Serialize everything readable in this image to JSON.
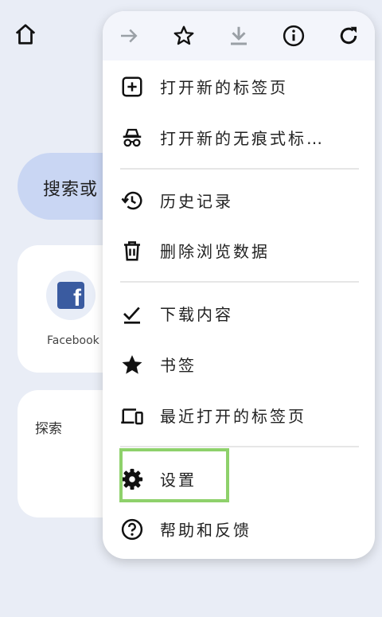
{
  "background": {
    "search_text": "搜索或",
    "shortcut_label": "Facebook",
    "explore_title": "探索"
  },
  "toolbar": {
    "icons": [
      "forward-icon",
      "star-outline-icon",
      "download-icon",
      "info-icon",
      "refresh-icon"
    ]
  },
  "menu": {
    "items": [
      {
        "label": "打开新的标签页",
        "icon": "new-tab-icon"
      },
      {
        "label": "打开新的无痕式标…",
        "icon": "incognito-icon"
      },
      {
        "label": "历史记录",
        "icon": "history-icon"
      },
      {
        "label": "删除浏览数据",
        "icon": "trash-icon"
      },
      {
        "label": "下载内容",
        "icon": "downloads-icon"
      },
      {
        "label": "书签",
        "icon": "star-filled-icon"
      },
      {
        "label": "最近打开的标签页",
        "icon": "devices-icon"
      },
      {
        "label": "设置",
        "icon": "gear-icon"
      },
      {
        "label": "帮助和反馈",
        "icon": "help-icon"
      }
    ]
  },
  "colors": {
    "accent_highlight": "#8ed16b",
    "search_pill": "#c9d6f3",
    "facebook": "#3a5ba0"
  }
}
